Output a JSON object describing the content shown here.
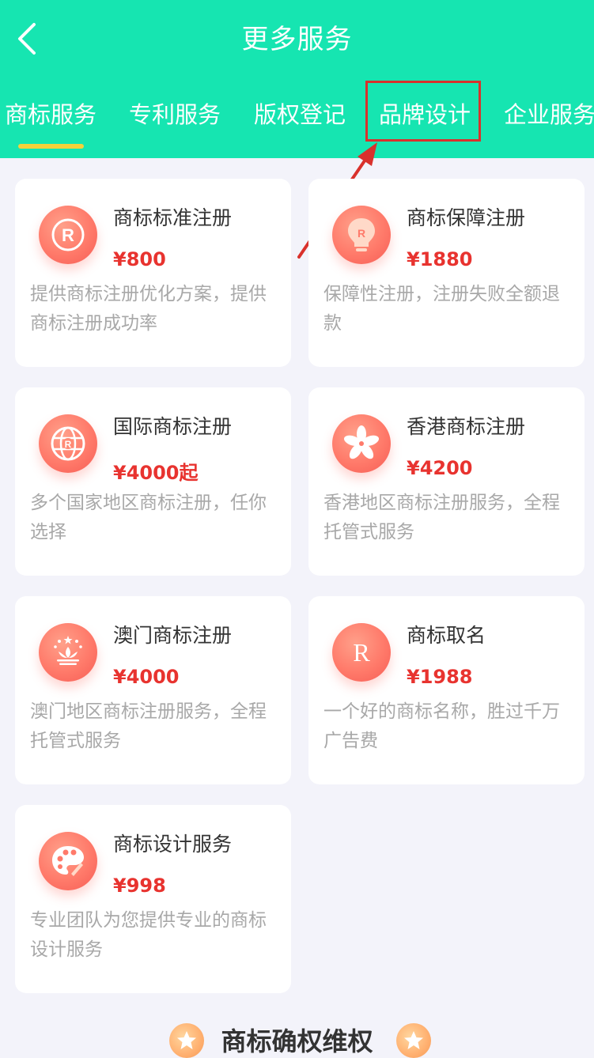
{
  "header": {
    "title": "更多服务",
    "back_icon": "chevron-left-icon"
  },
  "tabs": {
    "items": [
      {
        "label": "商标服务",
        "active": true
      },
      {
        "label": "专利服务",
        "active": false
      },
      {
        "label": "版权登记",
        "active": false
      },
      {
        "label": "品牌设计",
        "active": false,
        "highlighted": true
      },
      {
        "label": "企业服务",
        "active": false
      }
    ]
  },
  "services": [
    {
      "title": "商标标准注册",
      "price": "¥800",
      "desc": "提供商标注册优化方案，提供商标注册成功率",
      "icon": "registered-mark-icon"
    },
    {
      "title": "商标保障注册",
      "price": "¥1880",
      "desc": "保障性注册，注册失败全额退款",
      "icon": "lightbulb-r-icon"
    },
    {
      "title": "国际商标注册",
      "price": "¥4000起",
      "desc": "多个国家地区商标注册，任你选择",
      "icon": "globe-r-icon"
    },
    {
      "title": "香港商标注册",
      "price": "¥4200",
      "desc": "香港地区商标注册服务，全程托管式服务",
      "icon": "bauhinia-flower-icon"
    },
    {
      "title": "澳门商标注册",
      "price": "¥4000",
      "desc": "澳门地区商标注册服务，全程托管式服务",
      "icon": "lotus-emblem-icon"
    },
    {
      "title": "商标取名",
      "price": "¥1988",
      "desc": "一个好的商标名称，胜过千万广告费",
      "icon": "letter-r-icon"
    },
    {
      "title": "商标设计服务",
      "price": "¥998",
      "desc": "专业团队为您提供专业的商标设计服务",
      "icon": "palette-icon"
    }
  ],
  "section": {
    "title": "商标确权维权",
    "badge_icon": "star-badge-icon"
  },
  "colors": {
    "header_bg": "#16e5b1",
    "page_bg": "#f3f3fa",
    "price": "#e8332f",
    "indicator": "#f5d23a",
    "annotation": "#d9312c"
  }
}
